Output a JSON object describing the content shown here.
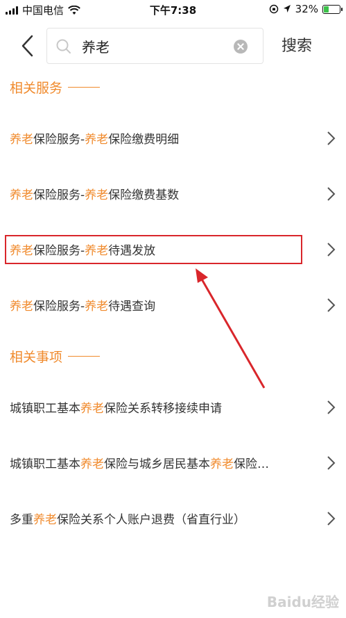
{
  "status_bar": {
    "carrier": "中国电信",
    "time": "下午7:38",
    "battery_percent": "32%",
    "battery_level": 0.32
  },
  "search": {
    "back_icon": "chevron-left-icon",
    "query": "养老",
    "search_button": "搜索"
  },
  "sections": {
    "services_title": "相关服务",
    "matters_title": "相关事项"
  },
  "services": [
    {
      "parts": [
        "养老",
        "保险服务-",
        "养老",
        "保险缴费明细"
      ]
    },
    {
      "parts": [
        "养老",
        "保险服务-",
        "养老",
        "保险缴费基数"
      ]
    },
    {
      "parts": [
        "养老",
        "保险服务-",
        "养老",
        "待遇发放"
      ]
    },
    {
      "parts": [
        "养老",
        "保险服务-",
        "养老",
        "待遇查询"
      ]
    }
  ],
  "matters": [
    {
      "parts": [
        "城镇职工基本",
        "养老",
        "保险关系转移接续申请"
      ]
    },
    {
      "parts": [
        "城镇职工基本",
        "养老",
        "保险与城乡居民基本",
        "养老",
        "保险…"
      ]
    },
    {
      "parts": [
        "多重",
        "养老",
        "保险关系个人账户退费（省直行业）"
      ]
    }
  ],
  "watermark": "Baidu经验",
  "colors": {
    "accent": "#f08a2c",
    "annotation_red": "#d9262b",
    "text": "#333333"
  }
}
